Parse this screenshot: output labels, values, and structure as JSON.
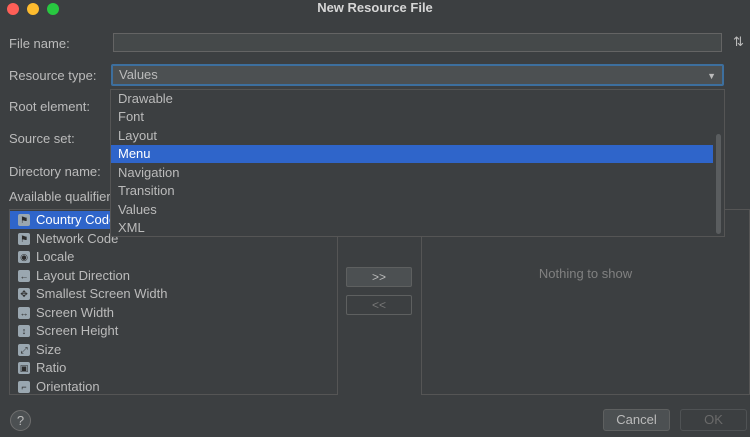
{
  "window": {
    "title": "New Resource File"
  },
  "form": {
    "file_name_label": "File name:",
    "file_name_value": "",
    "resource_type_label": "Resource type:",
    "resource_type_value": "Values",
    "root_element_label": "Root element:",
    "source_set_label": "Source set:",
    "directory_name_label": "Directory name:",
    "available_qualifiers_label": "Available qualifier"
  },
  "dropdown": {
    "options": [
      "Drawable",
      "Font",
      "Layout",
      "Menu",
      "Navigation",
      "Transition",
      "Values",
      "XML"
    ],
    "highlighted": "Menu"
  },
  "qualifiers": [
    {
      "label": "Country Code",
      "icon": "country-code-icon"
    },
    {
      "label": "Network Code",
      "icon": "network-code-icon"
    },
    {
      "label": "Locale",
      "icon": "globe-icon"
    },
    {
      "label": "Layout Direction",
      "icon": "arrow-left-icon"
    },
    {
      "label": "Smallest Screen Width",
      "icon": "resize-icon"
    },
    {
      "label": "Screen Width",
      "icon": "width-icon"
    },
    {
      "label": "Screen Height",
      "icon": "height-icon"
    },
    {
      "label": "Size",
      "icon": "size-icon"
    },
    {
      "label": "Ratio",
      "icon": "ratio-icon"
    },
    {
      "label": "Orientation",
      "icon": "orientation-icon"
    }
  ],
  "buttons": {
    "add": ">>",
    "remove": "<<",
    "cancel": "Cancel",
    "ok": "OK",
    "help": "?"
  },
  "chosen": {
    "empty_text": "Nothing to show"
  },
  "colors": {
    "accent": "#2f65ca",
    "background": "#3c3f41"
  }
}
